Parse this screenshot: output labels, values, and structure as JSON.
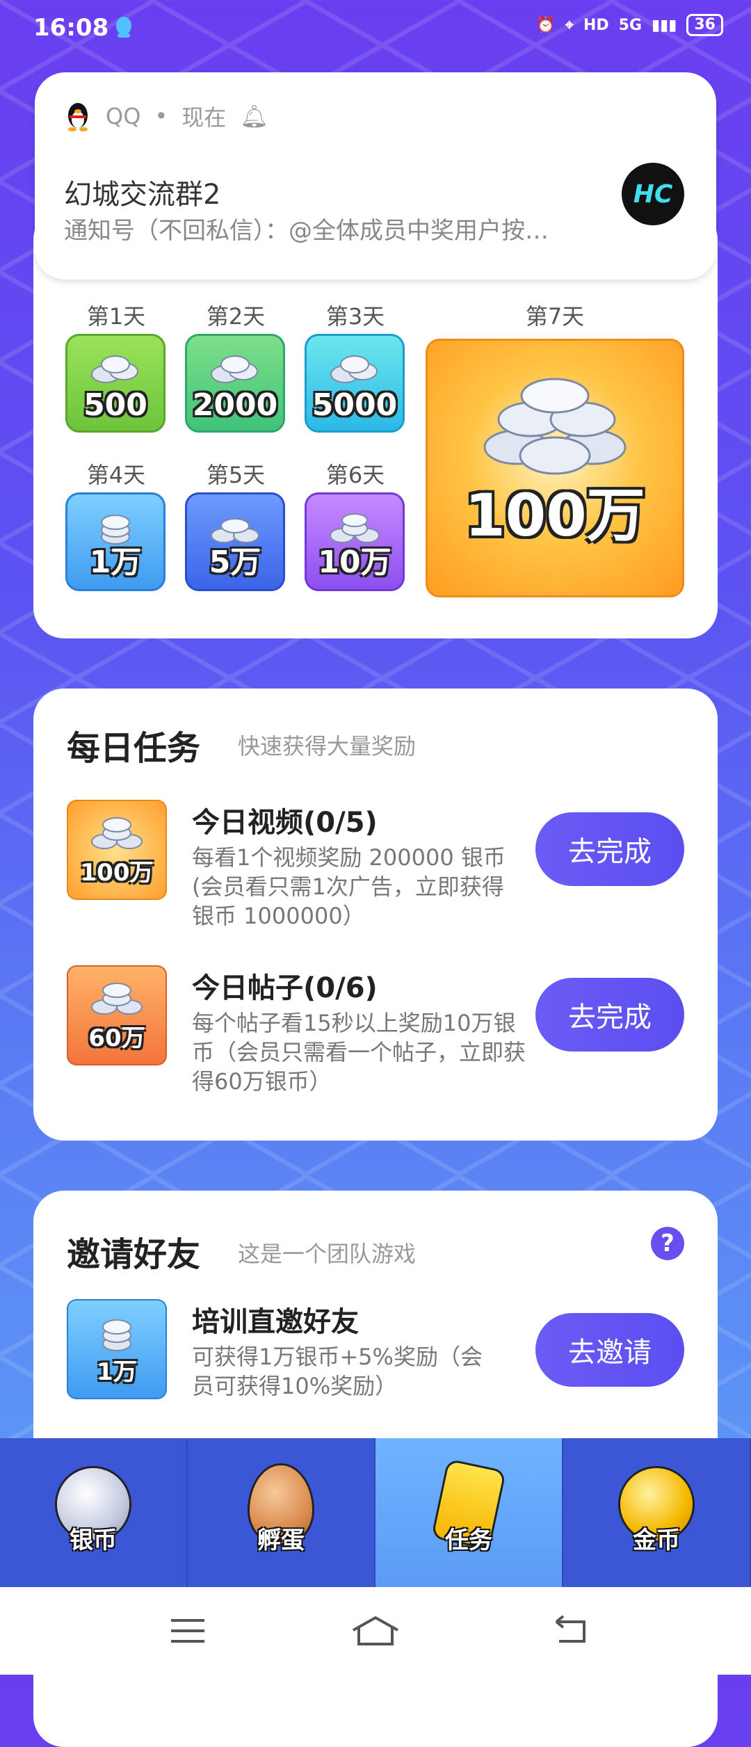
{
  "status_bar": {
    "time": "16:08",
    "indicators": [
      "HD",
      "5G"
    ],
    "battery": "36"
  },
  "notification": {
    "app_name": "QQ",
    "dot": "•",
    "time": "现在",
    "title": "幻城交流群2",
    "body": "通知号（不回私信）：@全体成员中奖用户按…",
    "avatar_text": "HC"
  },
  "signin": {
    "days": [
      {
        "label": "第1天",
        "amount": "500",
        "color": "green"
      },
      {
        "label": "第2天",
        "amount": "2000",
        "color": "teal"
      },
      {
        "label": "第3天",
        "amount": "5000",
        "color": "cyan"
      },
      {
        "label": "第4天",
        "amount": "1万",
        "color": "blue"
      },
      {
        "label": "第5天",
        "amount": "5万",
        "color": "royal"
      },
      {
        "label": "第6天",
        "amount": "10万",
        "color": "purple"
      },
      {
        "label": "第7天",
        "amount": "100万",
        "color": "orange"
      }
    ]
  },
  "daily_tasks": {
    "title": "每日任务",
    "subtitle": "快速获得大量奖励",
    "items": [
      {
        "icon_amount": "100万",
        "title": "今日视频(0/5)",
        "desc": "每看1个视频奖励 200000 银币(会员看只需1次广告，立即获得银币 1000000）",
        "button": "去完成"
      },
      {
        "icon_amount": "60万",
        "title": "今日帖子(0/6)",
        "desc": "每个帖子看15秒以上奖励10万银币（会员只需看一个帖子，立即获得60万银币）",
        "button": "去完成"
      }
    ]
  },
  "invite": {
    "title": "邀请好友",
    "subtitle": "这是一个团队游戏",
    "help": "?",
    "item": {
      "icon_amount": "1万",
      "title": "培训直邀好友",
      "desc": "可获得1万银币+5%奖励（会员可获得10%奖励）",
      "button": "去邀请"
    }
  },
  "tabbar": {
    "tabs": [
      {
        "label": "银币",
        "icon": "silver-coin-icon"
      },
      {
        "label": "孵蛋",
        "icon": "egg-icon"
      },
      {
        "label": "任务",
        "icon": "task-ticket-icon",
        "active": true
      },
      {
        "label": "金币",
        "icon": "gold-coin-icon"
      }
    ]
  }
}
